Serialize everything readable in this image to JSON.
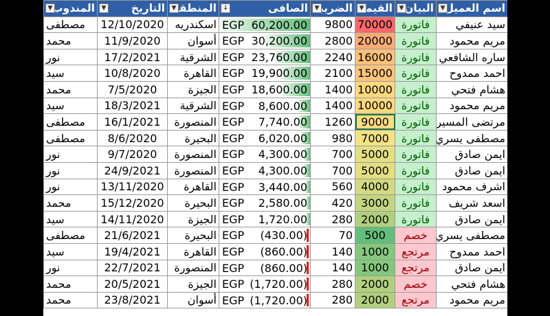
{
  "headers": {
    "customer": "اسم العميل",
    "type": "البيان",
    "value": "القيمة",
    "tax": "الضريبة",
    "net": "الصافى",
    "region": "المنطقة",
    "date": "التاريخ",
    "rep": "المندوب"
  },
  "filter_icon": "dropdown-arrow-icon",
  "sort_icon": "sort-descending-icon",
  "currency": "EGP",
  "colors": {
    "header": "#2f5fa6",
    "invoice_fill": "#c6efce",
    "return_fill": "#ffc7ce",
    "bar": "#63be7b"
  },
  "net_max": 60200,
  "rows": [
    {
      "customer": "سيد عنيفي",
      "type": "فاتورة",
      "kind": "inv",
      "value": "70000",
      "tax": "9800",
      "net": "60,200.00",
      "net_num": 60200,
      "region": "اسكندريه",
      "date": "12/10/2020",
      "rep": "مصطفى",
      "heat": "#f8696b"
    },
    {
      "customer": "مريم محمود",
      "type": "فاتورة",
      "kind": "inv",
      "value": "20000",
      "tax": "2800",
      "net": "30,200.00",
      "net_num": 30200,
      "region": "أسوان",
      "date": "11/9/2020",
      "rep": "محمد",
      "heat": "#fbab76"
    },
    {
      "customer": "ساره الشافعي",
      "type": "فاتورة",
      "kind": "inv",
      "value": "16000",
      "tax": "2240",
      "net": "23,760.00",
      "net_num": 23760,
      "region": "الشرقية",
      "date": "17/2/2021",
      "rep": "نور",
      "heat": "#fcc07b"
    },
    {
      "customer": "احمد ممدوح",
      "type": "فاتورة",
      "kind": "inv",
      "value": "15000",
      "tax": "2100",
      "net": "19,900.00",
      "net_num": 19900,
      "region": "القاهرة",
      "date": "10/8/2020",
      "rep": "سيد",
      "heat": "#fdc47d"
    },
    {
      "customer": "هشام فتحي",
      "type": "فاتورة",
      "kind": "inv",
      "value": "10000",
      "tax": "1400",
      "net": "18,600.00",
      "net_num": 18600,
      "region": "الجيزة",
      "date": "7/5/2020",
      "rep": "محمد",
      "heat": "#fed880"
    },
    {
      "customer": "مريم محمود",
      "type": "فاتورة",
      "kind": "inv",
      "value": "10000",
      "tax": "1400",
      "net": "8,600.00",
      "net_num": 8600,
      "region": "الشرقية",
      "date": "18/3/2021",
      "rep": "سيد",
      "heat": "#fed880"
    },
    {
      "customer": "مرتضى المسيري",
      "type": "فاتورة",
      "kind": "inv",
      "value": "9000",
      "tax": "1260",
      "net": "7,740.00",
      "net_num": 7740,
      "region": "المنصورة",
      "date": "16/1/2021",
      "rep": "مصطفى",
      "heat": "#ffdd82"
    },
    {
      "customer": "مصطفى يسري",
      "type": "فاتورة",
      "kind": "inv",
      "value": "7000",
      "tax": "980",
      "net": "6,020.00",
      "net_num": 6020,
      "region": "البحيرة",
      "date": "8/6/2020",
      "rep": "مصطفى",
      "heat": "#f4e383"
    },
    {
      "customer": "ايمن صادق",
      "type": "فاتورة",
      "kind": "inv",
      "value": "5000",
      "tax": "700",
      "net": "4,300.00",
      "net_num": 4300,
      "region": "المنصورة",
      "date": "9/7/2020",
      "rep": "نور",
      "heat": "#e3df82"
    },
    {
      "customer": "ايمن صادق",
      "type": "فاتورة",
      "kind": "inv",
      "value": "5000",
      "tax": "700",
      "net": "4,300.00",
      "net_num": 4300,
      "region": "المنصورة",
      "date": "24/9/2021",
      "rep": "نور",
      "heat": "#e3df82"
    },
    {
      "customer": "اشرف محمود",
      "type": "فاتورة",
      "kind": "inv",
      "value": "4000",
      "tax": "560",
      "net": "3,440.00",
      "net_num": 3440,
      "region": "القاهرة",
      "date": "13/11/2020",
      "rep": "نور",
      "heat": "#d2da81"
    },
    {
      "customer": "اسعد شريف",
      "type": "فاتورة",
      "kind": "inv",
      "value": "3000",
      "tax": "420",
      "net": "2,580.00",
      "net_num": 2580,
      "region": "البحيرة",
      "date": "15/12/2020",
      "rep": "محمد",
      "heat": "#c2d580"
    },
    {
      "customer": "ايمن صادق",
      "type": "فاتورة",
      "kind": "inv",
      "value": "2000",
      "tax": "280",
      "net": "1,720.00",
      "net_num": 1720,
      "region": "الجيزة",
      "date": "14/11/2020",
      "rep": "سيد",
      "heat": "#b1d07f"
    },
    {
      "customer": "مصطفى يسري",
      "type": "خصم",
      "kind": "ret",
      "value": "500",
      "tax": "70",
      "net": "(430.00)",
      "net_num": -430,
      "region": "البحيرة",
      "date": "21/6/2021",
      "rep": "مصطفى",
      "heat": "#63be7b"
    },
    {
      "customer": "احمد ممدوح",
      "type": "مرتجع",
      "kind": "ret",
      "value": "1000",
      "tax": "140",
      "net": "(860.00)",
      "net_num": -860,
      "region": "القاهرة",
      "date": "19/4/2021",
      "rep": "سيد",
      "heat": "#85c87d"
    },
    {
      "customer": "ايمن صادق",
      "type": "مرتجع",
      "kind": "ret",
      "value": "1000",
      "tax": "140",
      "net": "(860.00)",
      "net_num": -860,
      "region": "المنصورة",
      "date": "22/7/2021",
      "rep": "نور",
      "heat": "#85c87d"
    },
    {
      "customer": "هشام فتحي",
      "type": "خصم",
      "kind": "ret",
      "value": "2000",
      "tax": "280",
      "net": "(1,720.00)",
      "net_num": -1720,
      "region": "الجيزة",
      "date": "20/5/2021",
      "rep": "محمد",
      "heat": "#b1d07f"
    },
    {
      "customer": "مريم محمود",
      "type": "مرتجع",
      "kind": "ret",
      "value": "2000",
      "tax": "280",
      "net": "(1,720.00)",
      "net_num": -1720,
      "region": "أسوان",
      "date": "23/8/2021",
      "rep": "محمد",
      "heat": "#b1d07f"
    }
  ]
}
